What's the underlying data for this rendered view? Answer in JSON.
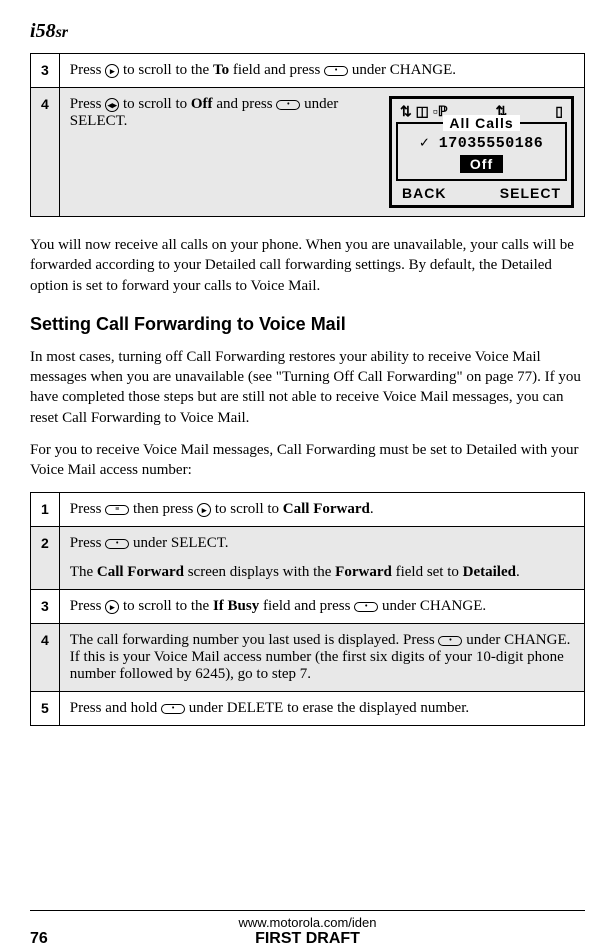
{
  "logo": {
    "prefix": "i",
    "num": "58",
    "suffix": "sr"
  },
  "table1": {
    "rows": [
      {
        "num": "3",
        "text_before": "Press ",
        "sym1": "▸",
        "text_mid1": " to scroll to the ",
        "bold1": "To",
        "text_mid2": " field and press ",
        "sym2": "•",
        "text_after": " under CHANGE."
      },
      {
        "num": "4",
        "text_before": "Press ",
        "sym1": "◂▸",
        "text_mid1": " to scroll to ",
        "bold1": "Off",
        "text_mid2": " and press ",
        "sym2": "•",
        "text_after": " under SELECT."
      }
    ]
  },
  "screen": {
    "icons_left": "⇅ ◫ ▫ℙ",
    "icons_mid": "⇅",
    "icons_right": "▯",
    "title": "All Calls",
    "number": "✓ 17035550186",
    "selected": "Off",
    "soft_left": "BACK",
    "soft_right": "SELECT"
  },
  "para1": "You will now receive all calls on your phone. When you are unavailable, your calls will be forwarded according to your Detailed call forwarding settings. By default, the Detailed option is set to forward your calls to Voice Mail.",
  "heading": "Setting Call Forwarding to Voice Mail",
  "para2": "In most cases, turning off Call Forwarding restores your ability to receive Voice Mail messages when you are unavailable (see \"Turning Off Call Forwarding\" on page 77). If you have completed those steps but are still not able to receive Voice Mail messages, you can reset Call Forwarding to Voice Mail.",
  "para3": "For you to receive Voice Mail messages, Call Forwarding must be set to Detailed with your Voice Mail access number:",
  "table2": {
    "rows": [
      {
        "num": "1",
        "parts": {
          "p0": "Press ",
          "sym0": "≡",
          "p1": " then press ",
          "sym1": "▸",
          "p2": " to scroll to ",
          "bold": "Call Forward",
          "p3": "."
        }
      },
      {
        "num": "2",
        "line1": {
          "p0": "Press ",
          "sym0": "•",
          "p1": " under SELECT."
        },
        "line2": {
          "p0": "The ",
          "b0": "Call Forward",
          "p1": " screen displays with the ",
          "b1": "Forward",
          "p2": " field set to ",
          "b2": "Detailed",
          "p3": "."
        }
      },
      {
        "num": "3",
        "parts": {
          "p0": "Press ",
          "sym0": "▸",
          "p1": " to scroll to the ",
          "bold": "If Busy",
          "p2": " field and press ",
          "sym1": "•",
          "p3": " under CHANGE."
        }
      },
      {
        "num": "4",
        "parts": {
          "p0": "The call forwarding number you last used is displayed. Press ",
          "sym0": "•",
          "p1": " under CHANGE. If this is your Voice Mail access number (the first six digits of your 10-digit phone number followed by 6245), go to step 7."
        }
      },
      {
        "num": "5",
        "parts": {
          "p0": "Press and hold ",
          "sym0": "•",
          "p1": " under DELETE to erase the displayed number."
        }
      }
    ]
  },
  "footer": {
    "url": "www.motorola.com/iden",
    "page": "76",
    "draft": "FIRST DRAFT"
  }
}
